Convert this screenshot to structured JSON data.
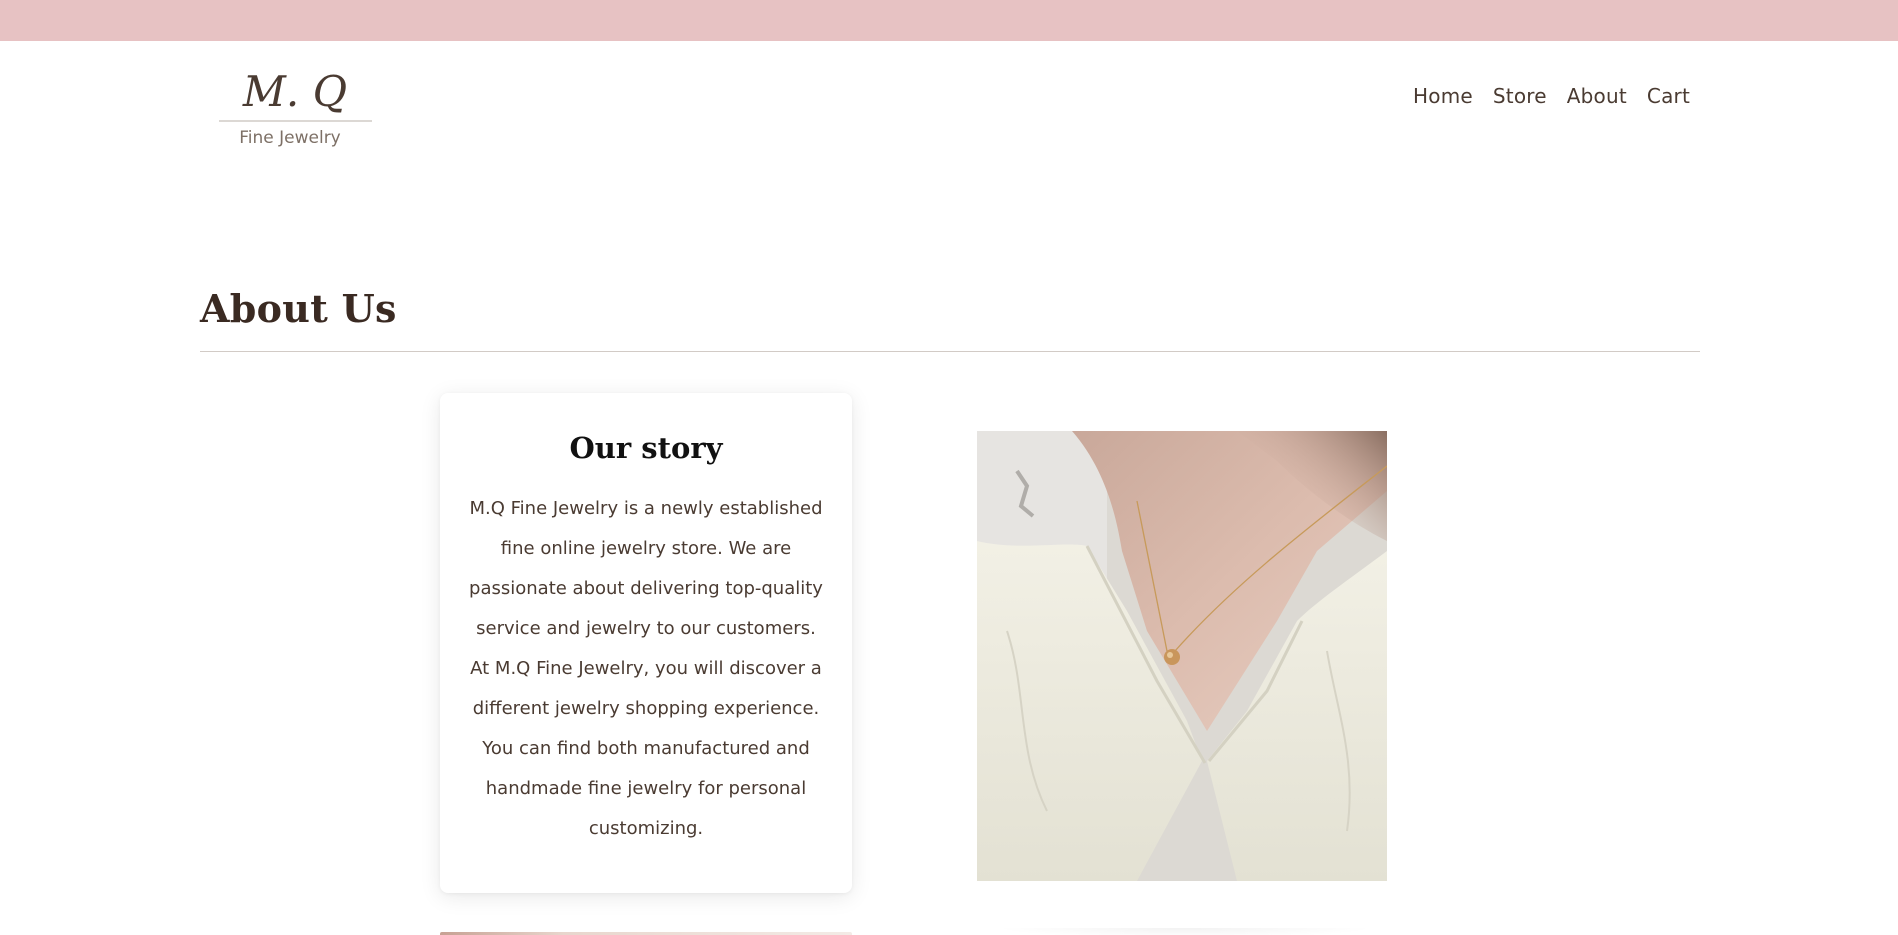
{
  "brand": {
    "monogram": "M. Q",
    "tagline": "Fine Jewelry",
    "accent_color": "#e7c2c3"
  },
  "nav": {
    "items": [
      "Home",
      "Store",
      "About",
      "Cart"
    ]
  },
  "page": {
    "title": "About Us"
  },
  "story": {
    "heading": "Our story",
    "body": "M.Q Fine Jewelry is a newly established fine online jewelry store. We are passionate about delivering top-quality service and jewelry to our customers. At M.Q Fine Jewelry, you will discover a different jewelry shopping experience. You can find both manufactured and handmade fine jewelry for personal customizing."
  },
  "image": {
    "subject": "woman wearing gold pendant necklace with cream blouse"
  }
}
